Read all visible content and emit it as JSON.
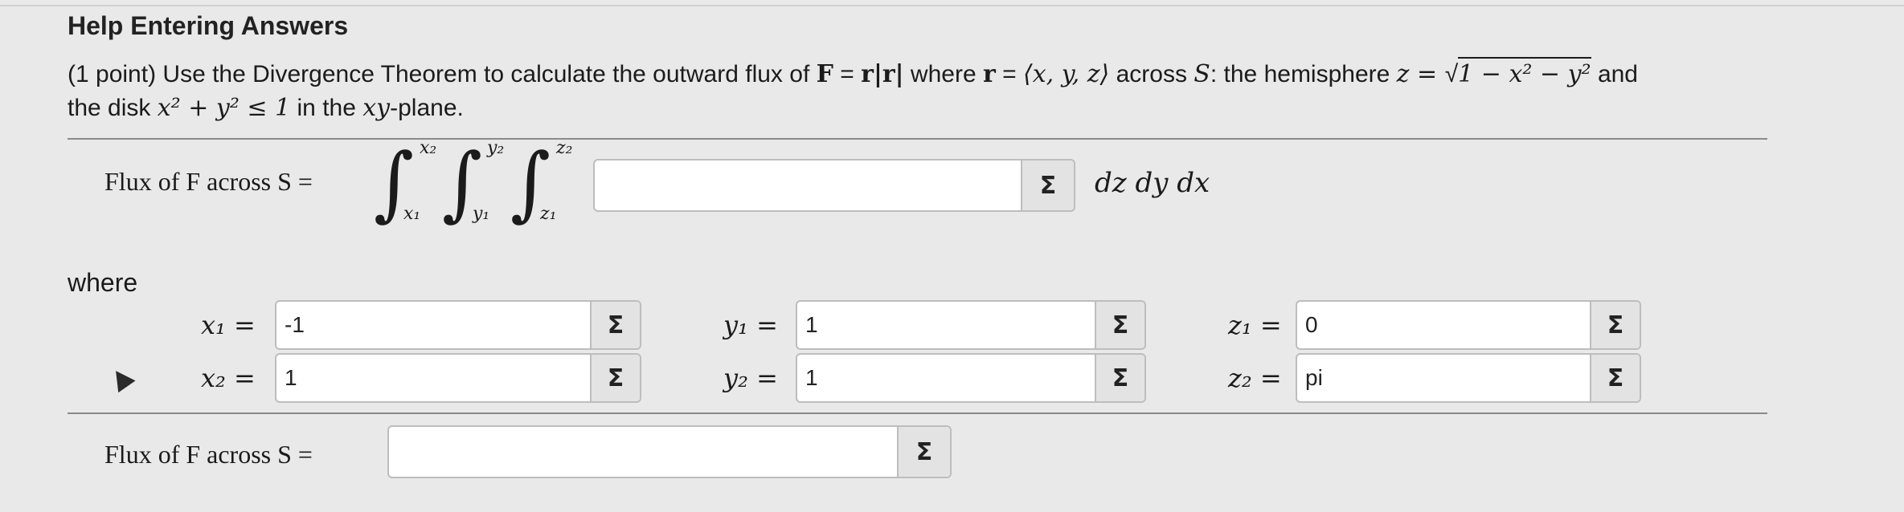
{
  "help_link": "Help Entering Answers",
  "problem": {
    "points": "(1 point)",
    "text1": "Use the Divergence Theorem to calculate the outward flux of",
    "F": "F",
    "eq": " = ",
    "rr": "r|r|",
    "where_r": "where",
    "r": "r",
    "r_def": "⟨x, y, z⟩",
    "across": "across",
    "S": "S",
    "colon_text": ": the hemisphere",
    "z_eq": "z = ",
    "sqrt_sym": "√",
    "sqrt_body": "1 − x² − y²",
    "and": "and",
    "line2_start": "the disk",
    "disk_ineq": "x² + y² ≤ 1",
    "in_the": "in the",
    "xy": "xy",
    "plane": "-plane."
  },
  "integral": {
    "label": "Flux of F across S =",
    "x_upper": "x₂",
    "x_lower": "x₁",
    "y_upper": "y₂",
    "y_lower": "y₁",
    "z_upper": "z₂",
    "z_lower": "z₁",
    "integrand_value": "",
    "differentials": "dz dy dx"
  },
  "where_label": "where",
  "limits": {
    "x1": {
      "label": "x₁ =",
      "value": "-1"
    },
    "x2": {
      "label": "x₂ =",
      "value": "1"
    },
    "y1": {
      "label": "y₁ =",
      "value": "1"
    },
    "y2": {
      "label": "y₂ =",
      "value": "1"
    },
    "z1": {
      "label": "z₁ =",
      "value": "0"
    },
    "z2": {
      "label": "z₂ =",
      "value": "pi"
    }
  },
  "final": {
    "label": "Flux of F across S =",
    "value": ""
  },
  "sigma_label": "Σ",
  "icons": {
    "sigma": "sigma-equation-editor-icon",
    "cursor": "mouse-pointer-icon"
  }
}
